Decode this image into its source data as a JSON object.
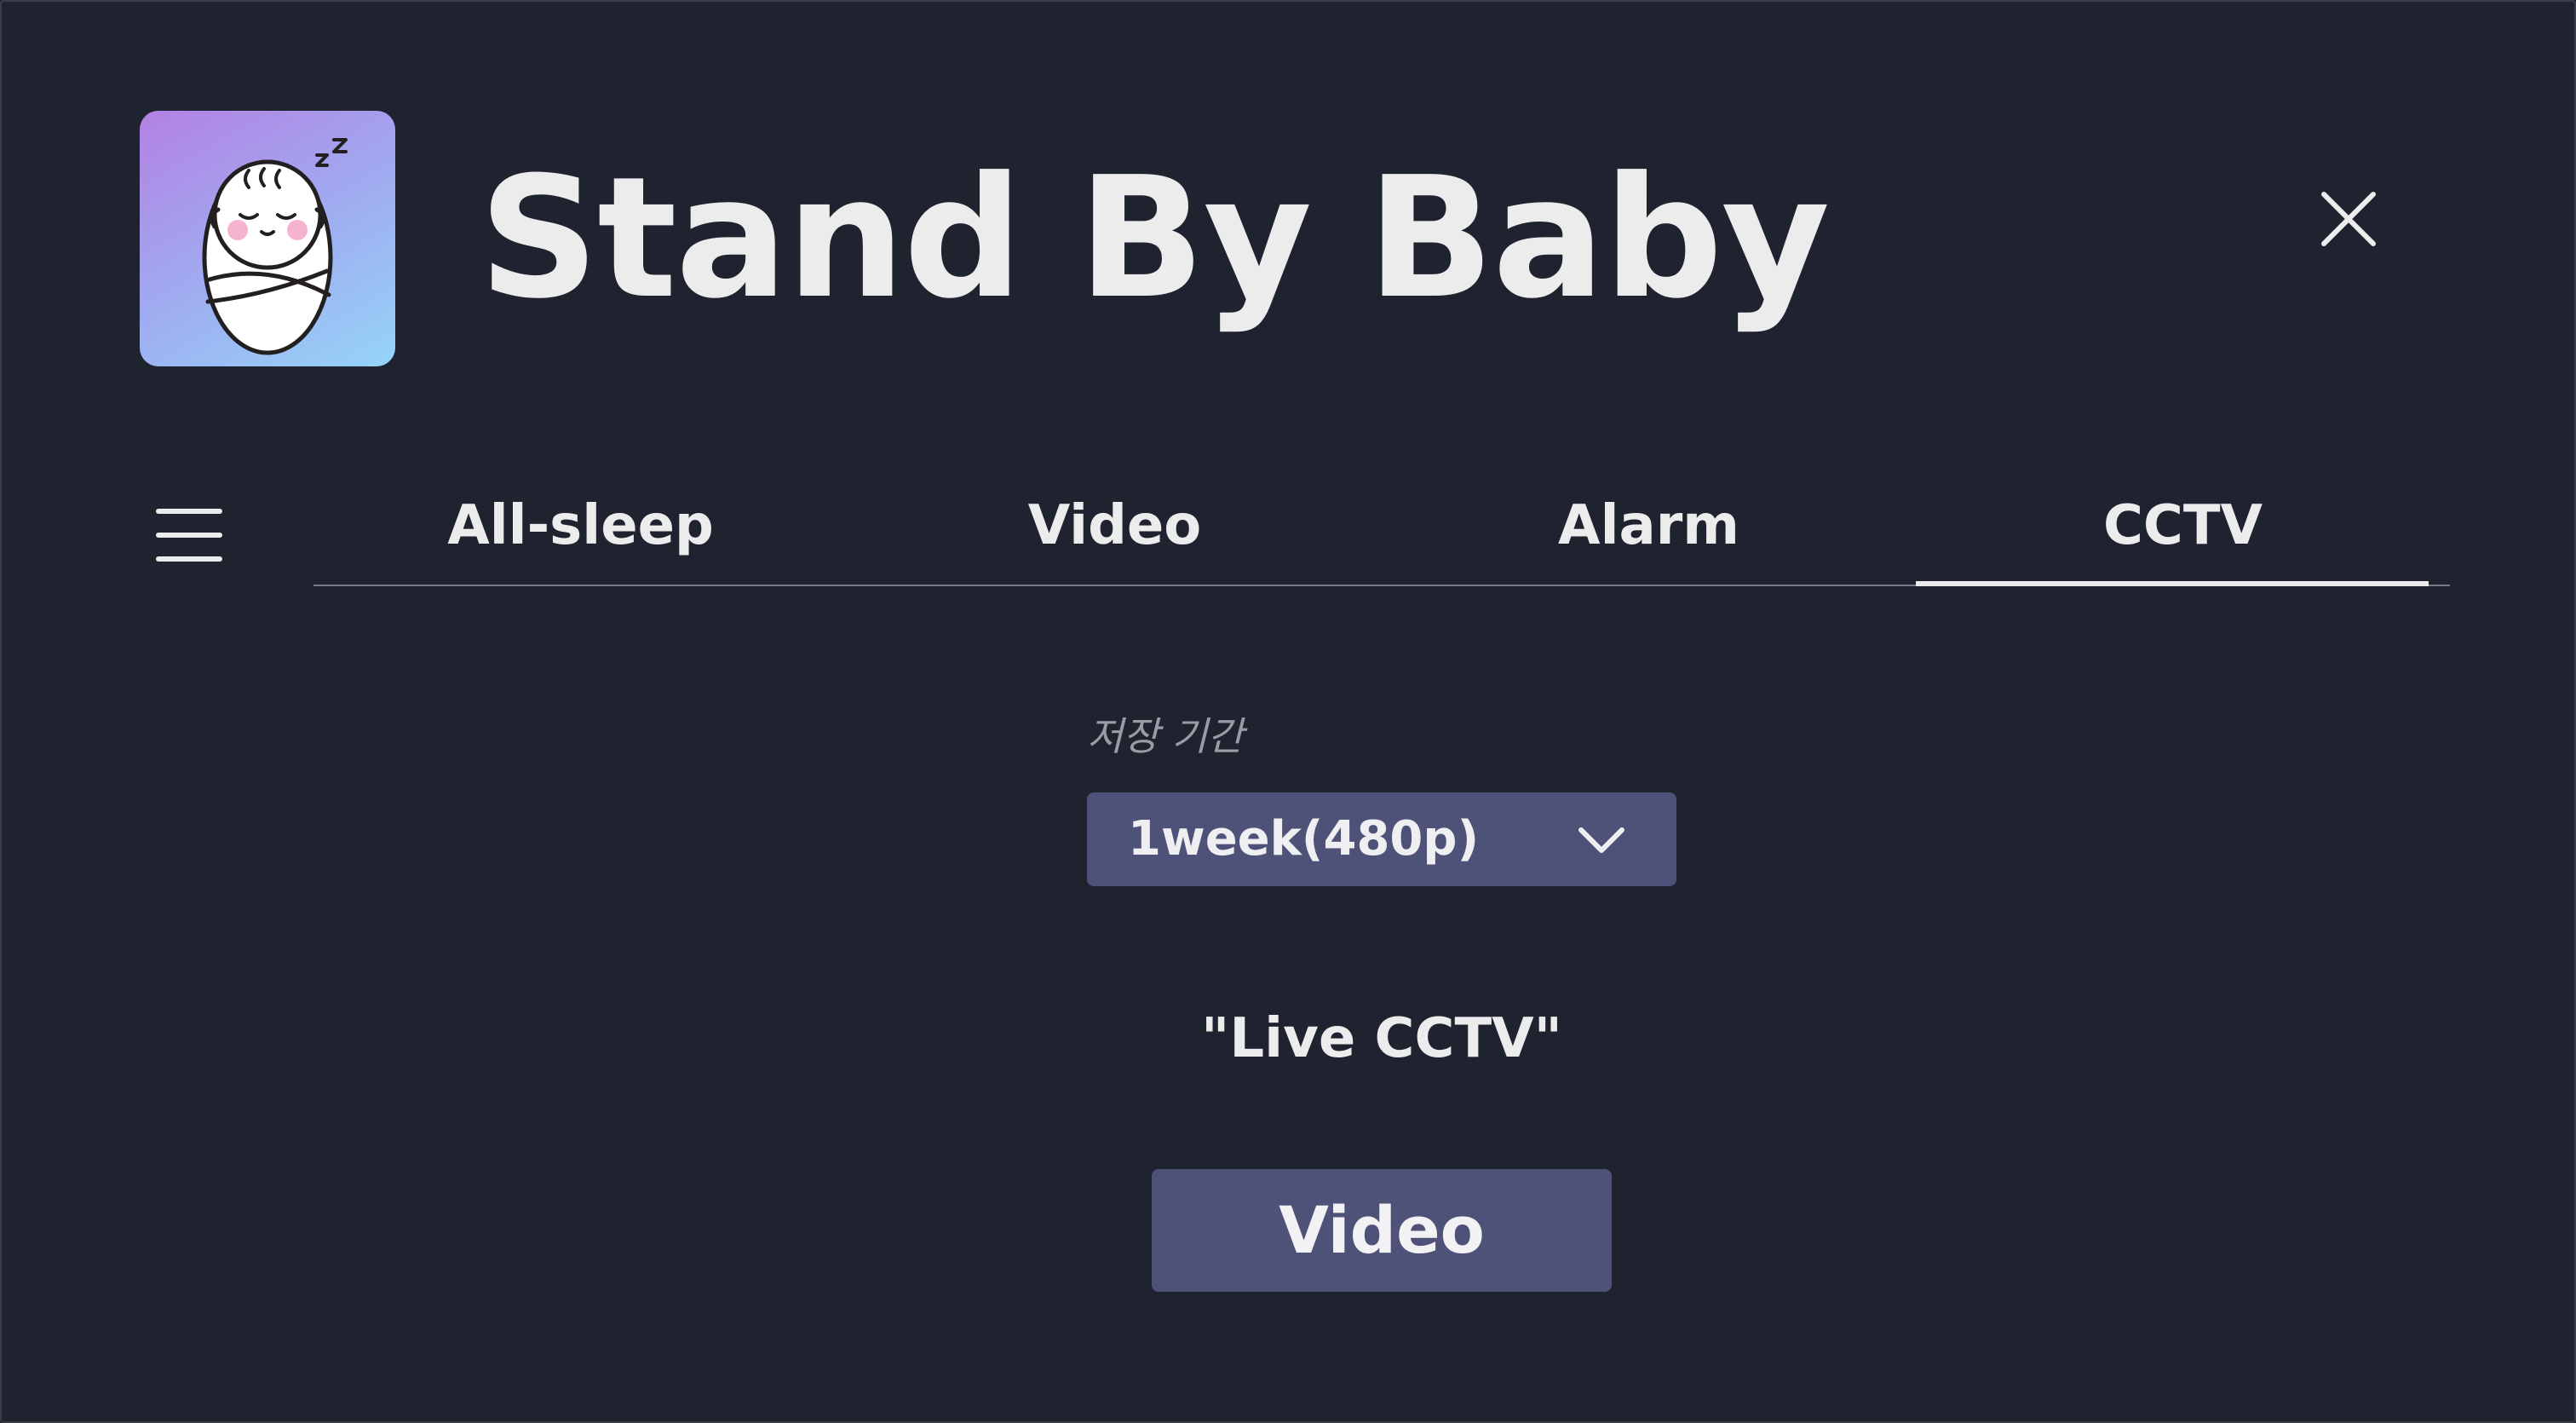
{
  "app": {
    "title": "Stand By Baby",
    "logo_icon": "sleeping-baby-icon",
    "close_icon": "close-icon",
    "menu_icon": "hamburger-menu-icon"
  },
  "tabs": [
    {
      "label": "All-sleep",
      "active": false
    },
    {
      "label": "Video",
      "active": false
    },
    {
      "label": "Alarm",
      "active": false
    },
    {
      "label": "CCTV",
      "active": true
    }
  ],
  "storage": {
    "label": "저장 기간",
    "selected": "1week(480p)",
    "chevron_icon": "chevron-down-icon"
  },
  "live": {
    "label": "\"Live CCTV\""
  },
  "video_button": {
    "label": "Video"
  },
  "colors": {
    "background": "#1f2330",
    "accent": "#4f5278",
    "text": "#ececec",
    "muted_text": "#9a9ca3",
    "logo_gradient_start": "#b381e3",
    "logo_gradient_end": "#95d4f8"
  }
}
